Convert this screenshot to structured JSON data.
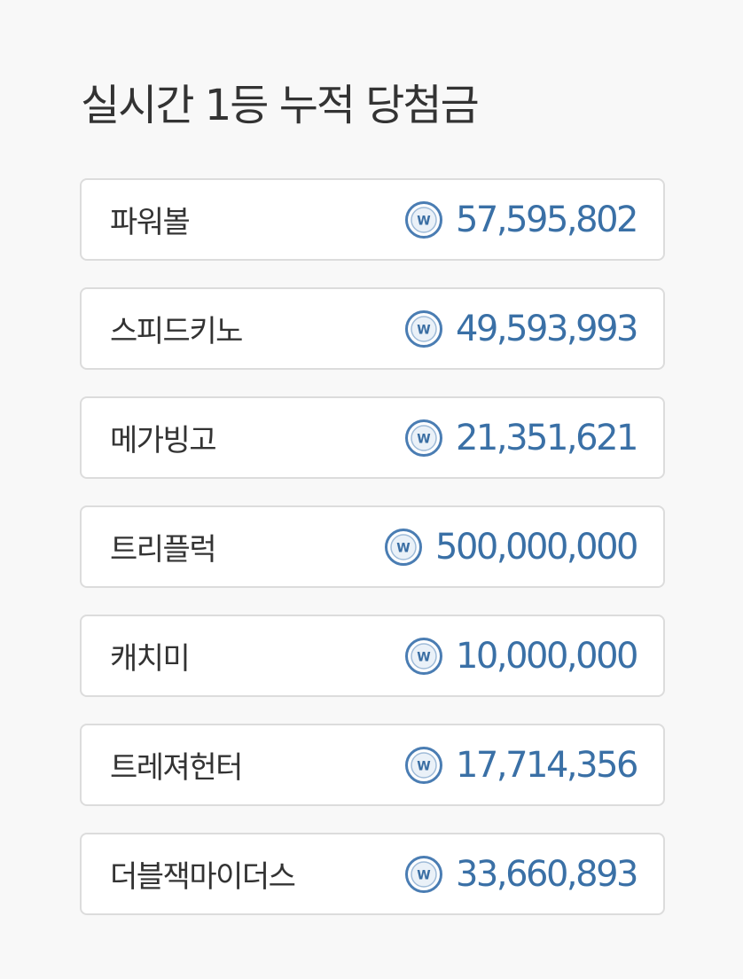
{
  "title": "실시간 1등 누적 당첨금",
  "colors": {
    "amount": "#3a70a6",
    "icon_ring": "#4a7db3",
    "text": "#333333",
    "border": "#dcdcdc"
  },
  "icon": "won-coin-icon",
  "items": [
    {
      "name": "파워볼",
      "amount": "57,595,802"
    },
    {
      "name": "스피드키노",
      "amount": "49,593,993"
    },
    {
      "name": "메가빙고",
      "amount": "21,351,621"
    },
    {
      "name": "트리플럭",
      "amount": "500,000,000"
    },
    {
      "name": "캐치미",
      "amount": "10,000,000"
    },
    {
      "name": "트레져헌터",
      "amount": "17,714,356"
    },
    {
      "name": "더블잭마이더스",
      "amount": "33,660,893"
    }
  ]
}
